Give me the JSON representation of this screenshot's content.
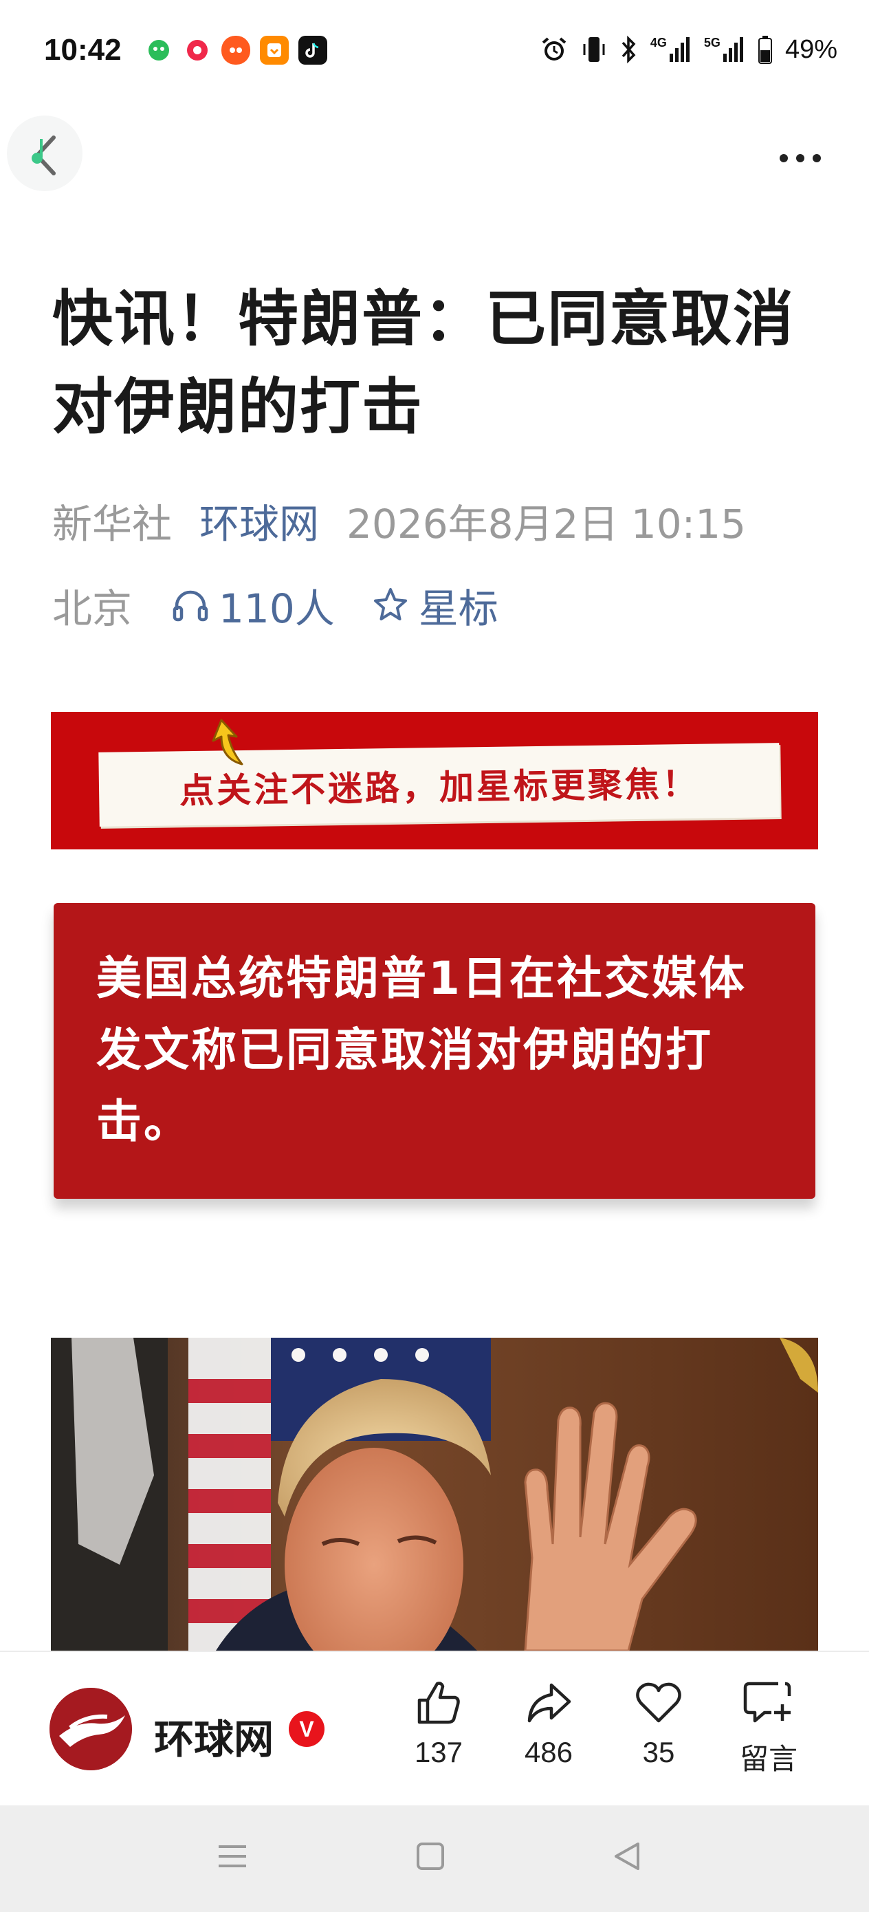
{
  "status_bar": {
    "time": "10:42",
    "network_4g": "4G",
    "network_5g": "5G",
    "battery": "49%",
    "app_icons": [
      "wechat-icon",
      "weibo-icon",
      "taobao-icon",
      "orange-app-icon",
      "douyin-icon"
    ]
  },
  "nav": {
    "back_icon": "back-arrow-icon",
    "more_icon": "more-dots-icon"
  },
  "article": {
    "title": "快讯！特朗普：已同意取消对伊朗的打击",
    "source_primary": "新华社",
    "source_secondary": "环球网",
    "datetime": "2026年8月2日 10:15",
    "location": "北京",
    "listeners": "110人",
    "star_label": "星标"
  },
  "follow_banner": {
    "text": "点关注不迷路，加星标更聚焦！"
  },
  "summary": {
    "text": "美国总统特朗普1日在社交媒体发文称已同意取消对伊朗的打击。"
  },
  "action_bar": {
    "source_name": "环球网",
    "verified_label": "V",
    "likes": "137",
    "shares": "486",
    "favorites": "35",
    "comment_label": "留言"
  },
  "colors": {
    "brand_red": "#c8080c",
    "summary_red": "#b41618",
    "link_blue": "#4d6a99",
    "meta_gray": "#9a9a9a"
  }
}
